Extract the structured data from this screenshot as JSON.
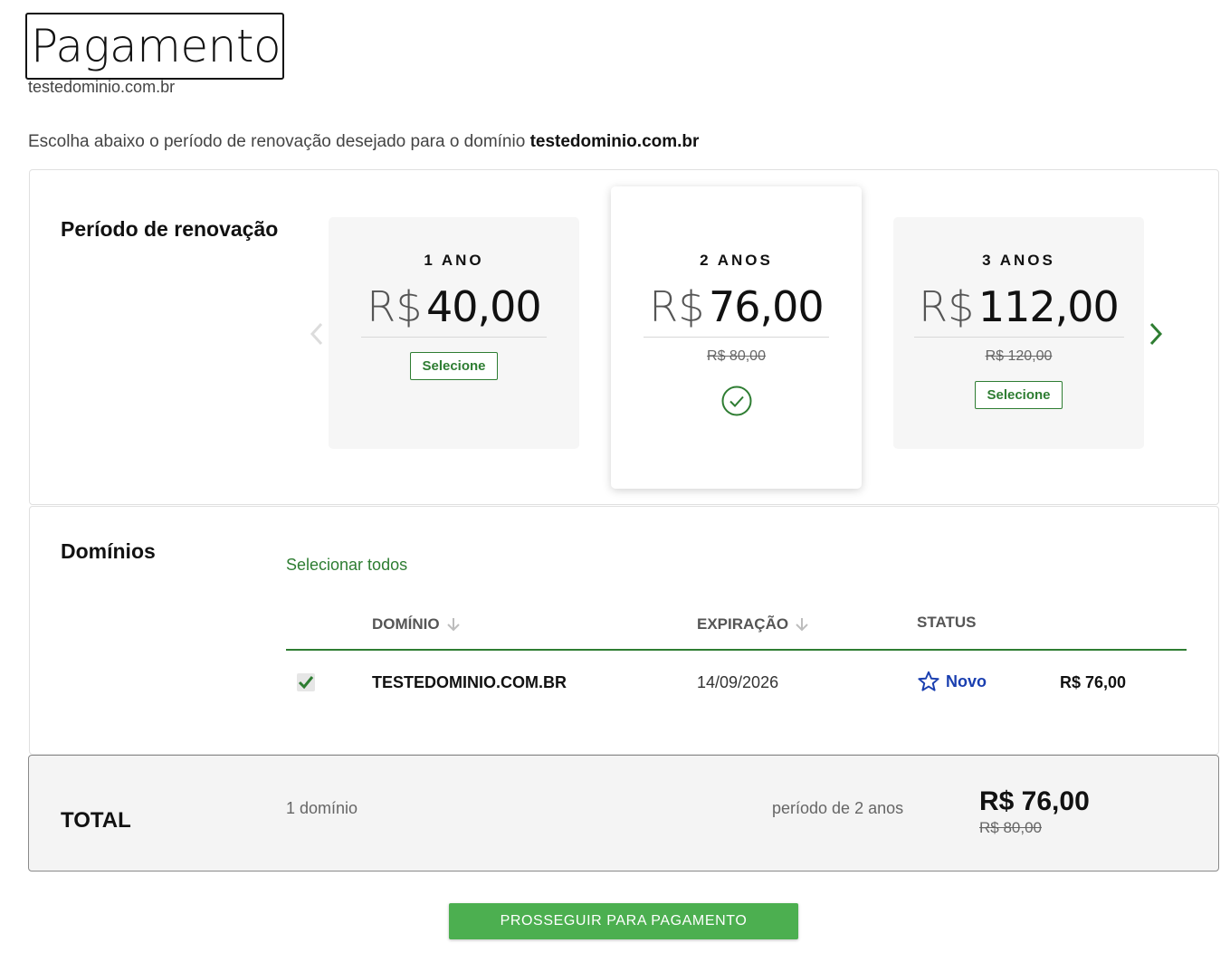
{
  "header": {
    "title": "Pagamento",
    "subtitle": "testedominio.com.br"
  },
  "intro": {
    "text": "Escolha abaixo o período de renovação desejado para o domínio ",
    "domain": "testedominio.com.br"
  },
  "renewal": {
    "label": "Período de renovação",
    "nav": {
      "prev_icon": "chevron-left-icon",
      "next_icon": "chevron-right-icon"
    },
    "plans": [
      {
        "period": "1 ANO",
        "currency": "R$",
        "amount": "40,00",
        "old_price": "",
        "select_label": "Selecione",
        "selected": false
      },
      {
        "period": "2 ANOS",
        "currency": "R$",
        "amount": "76,00",
        "old_price": "R$ 80,00",
        "select_label": "",
        "selected": true
      },
      {
        "period": "3 ANOS",
        "currency": "R$",
        "amount": "112,00",
        "old_price": "R$ 120,00",
        "select_label": "Selecione",
        "selected": false
      }
    ]
  },
  "domains": {
    "label": "Domínios",
    "select_all": "Selecionar todos",
    "columns": {
      "domain": "DOMÍNIO",
      "expiration": "EXPIRAÇÃO",
      "status": "STATUS"
    },
    "rows": [
      {
        "checked": true,
        "domain": "TESTEDOMINIO.COM.BR",
        "expiration": "14/09/2026",
        "status": "Novo",
        "price": "R$ 76,00"
      }
    ]
  },
  "total": {
    "label": "TOTAL",
    "count": "1 domínio",
    "period": "período de 2 anos",
    "price": "R$ 76,00",
    "old_price": "R$ 80,00"
  },
  "actions": {
    "proceed_label": "PROSSEGUIR PARA PAGAMENTO"
  },
  "colors": {
    "accent_green": "#2e7d32",
    "button_green": "#4caf50",
    "status_blue": "#1a3fb0"
  }
}
